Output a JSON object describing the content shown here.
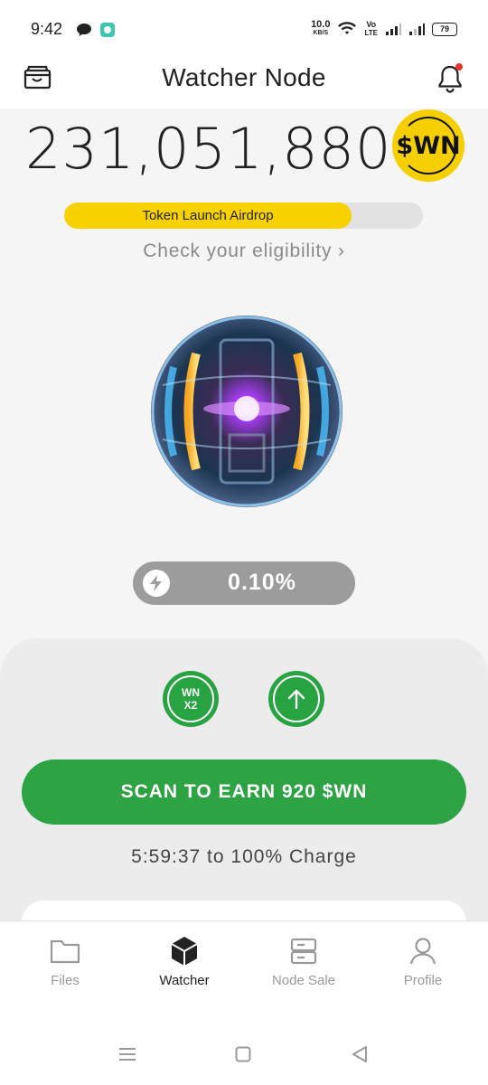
{
  "status_bar": {
    "time": "9:42",
    "net_speed": "10.0",
    "net_unit": "KB/S",
    "volte": "Vo",
    "lte": "LTE",
    "battery": "79"
  },
  "header": {
    "title": "Watcher Node"
  },
  "balance": {
    "amount": "231,051,880",
    "token": "$WN"
  },
  "airdrop": {
    "label": "Token Launch Airdrop",
    "progress": 0.8,
    "eligibility": "Check your eligibility ›"
  },
  "boost": {
    "value": "0.10%"
  },
  "actions": {
    "multiplier_top": "WN",
    "multiplier_bottom": "X2",
    "scan_label": "SCAN TO EARN 920 $WN",
    "charge_text": "5:59:37 to 100% Charge"
  },
  "bottom_nav": {
    "items": [
      {
        "label": "Files",
        "icon": "folder-icon",
        "active": false
      },
      {
        "label": "Watcher",
        "icon": "cube-icon",
        "active": true
      },
      {
        "label": "Node Sale",
        "icon": "server-icon",
        "active": false
      },
      {
        "label": "Profile",
        "icon": "user-icon",
        "active": false
      }
    ]
  },
  "colors": {
    "accent_yellow": "#f8d200",
    "accent_green": "#2ea344",
    "pill_gray": "#9c9c9c"
  }
}
